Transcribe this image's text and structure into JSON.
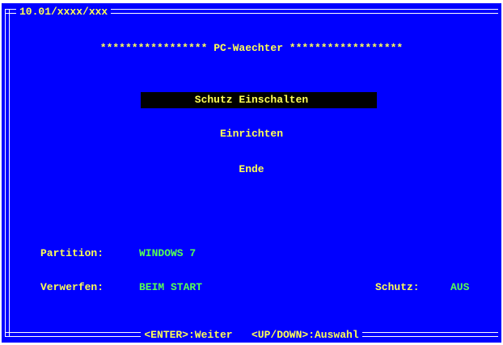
{
  "window": {
    "title": "10.01/xxxx/xxx"
  },
  "banner": {
    "text": "***************** PC-Waechter ******************"
  },
  "menu": {
    "items": [
      {
        "label": "Schutz Einschalten",
        "selected": true
      },
      {
        "label": "Einrichten",
        "selected": false
      },
      {
        "label": "Ende",
        "selected": false
      }
    ]
  },
  "status": {
    "partition_label": "Partition:",
    "partition_value": "WINDOWS 7",
    "discard_label": "Verwerfen:",
    "discard_value": "BEIM START",
    "protection_label": "Schutz:",
    "protection_value": "AUS"
  },
  "footer": {
    "hint": "<ENTER>:Weiter   <UP/DOWN>:Auswahl"
  },
  "colors": {
    "background": "#0000ff",
    "text_primary": "#ffff55",
    "text_value": "#55ff55",
    "selection_bar": "#000000",
    "frame": "#ffffff"
  }
}
